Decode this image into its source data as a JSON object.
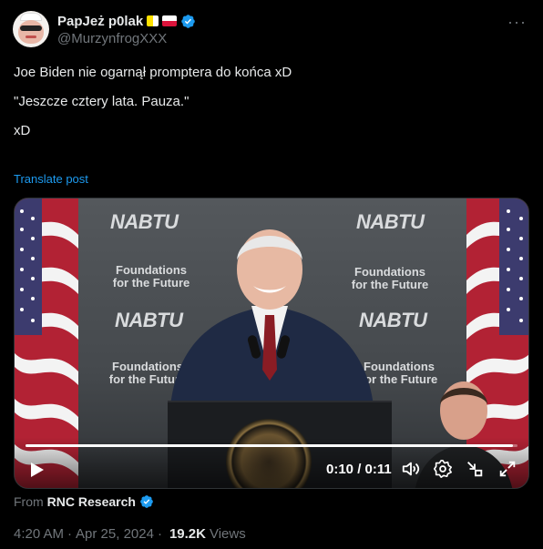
{
  "author": {
    "display_name": "PapJeż p0lak",
    "handle": "@MurzynfrogXXX",
    "verified": true
  },
  "tweet": {
    "lines": [
      "Joe Biden nie ogarnął promptera do końca xD",
      "\"Jeszcze cztery lata. Pauza.\"",
      "xD"
    ],
    "translate_label": "Translate post"
  },
  "video": {
    "backdrop_texts": {
      "logo": "NABTU",
      "foundation_line1": "Foundations",
      "foundation_line2": "for the Future"
    },
    "progress_fraction": 0.99,
    "time_display": "0:10 / 0:11"
  },
  "source": {
    "prefix": "From",
    "name": "RNC Research"
  },
  "meta": {
    "time": "4:20 AM",
    "date": "Apr 25, 2024",
    "views_count": "19.2K",
    "views_label": "Views"
  },
  "icons": {
    "more": "more-icon",
    "verified": "verified-badge-icon",
    "play": "play-icon",
    "volume": "volume-icon",
    "settings": "settings-icon",
    "minimize": "minimize-icon",
    "fullscreen": "fullscreen-icon"
  },
  "colors": {
    "accent": "#1d9bf0",
    "text": "#e7e9ea",
    "muted": "#71767b",
    "background": "#000000"
  }
}
